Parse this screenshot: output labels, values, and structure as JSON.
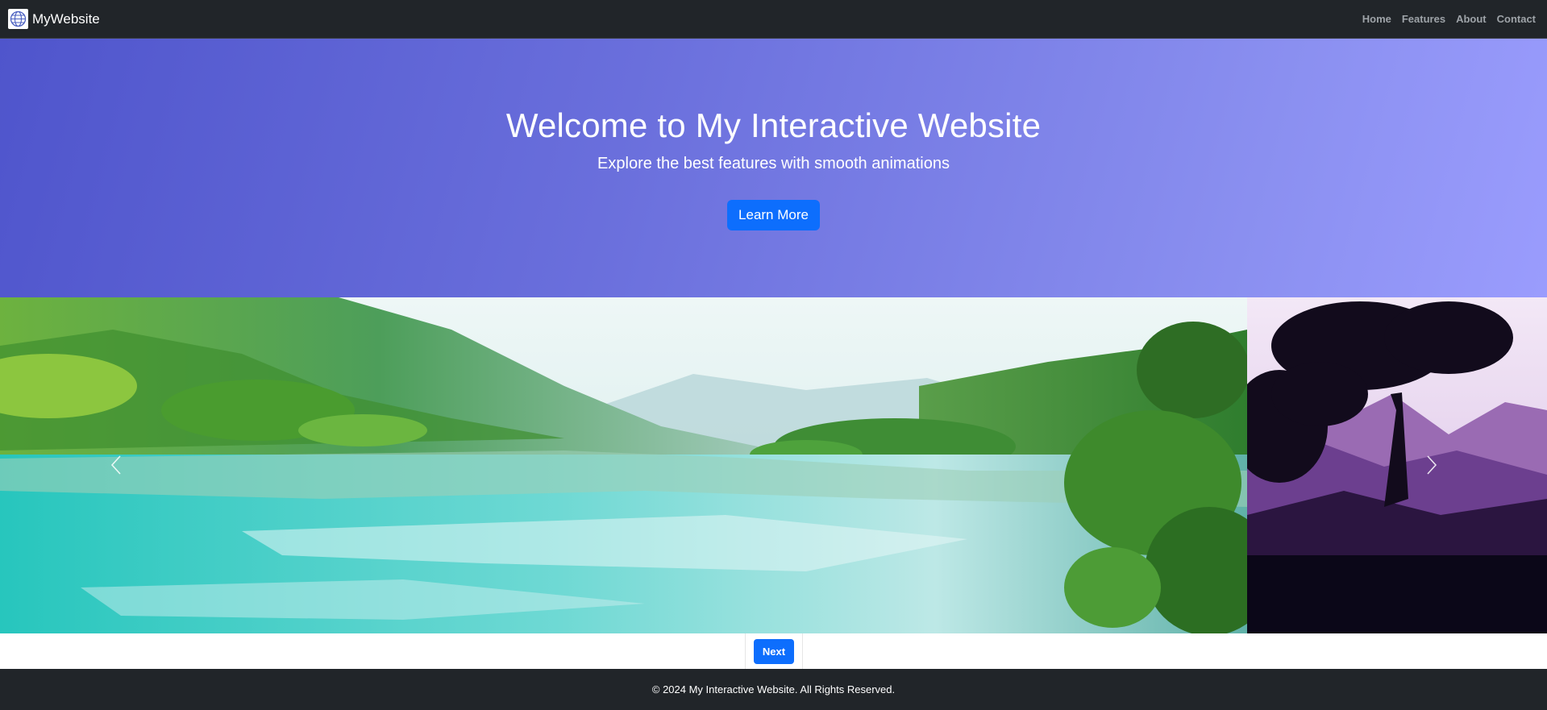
{
  "navbar": {
    "brand": "MyWebsite",
    "brand_icon": "globe-icon",
    "links": [
      "Home",
      "Features",
      "About",
      "Contact"
    ]
  },
  "hero": {
    "title": "Welcome to My Interactive Website",
    "subtitle": "Explore the best features with smooth animations",
    "button_label": "Learn More"
  },
  "carousel": {
    "slides": [
      "lake-landscape-image",
      "purple-mountain-silhouette-image"
    ],
    "prev_icon": "chevron-left-icon",
    "next_icon": "chevron-right-icon",
    "next_button_label": "Next"
  },
  "footer": {
    "text": "© 2024 My Interactive Website. All Rights Reserved."
  },
  "colors": {
    "nav_bg": "#212529",
    "hero_gradient_start": "#4f55cc",
    "hero_gradient_end": "#9a9cfd",
    "primary_button": "#0d6efd"
  }
}
